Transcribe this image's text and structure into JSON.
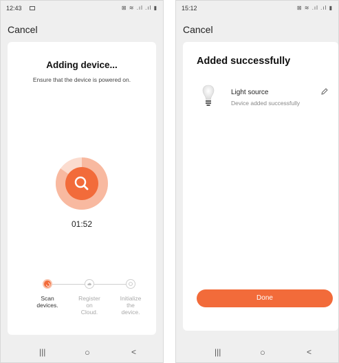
{
  "colors": {
    "accent": "#f26b3a",
    "ring": "#f8c4ae",
    "ring_light": "#fbdccf"
  },
  "left": {
    "status": {
      "time": "12:43",
      "icons": "⊠ ≋ .ıl .ıl ▮"
    },
    "cancel_label": "Cancel",
    "title": "Adding device...",
    "subtitle": "Ensure that the device is powered on.",
    "timer": "01:52",
    "steps": [
      {
        "label": "Scan devices.",
        "icon": "spinner-icon",
        "active": true
      },
      {
        "label": "Register on Cloud.",
        "icon": "cloud-icon",
        "active": false
      },
      {
        "label": "Initialize the device.",
        "icon": "check-circle-icon",
        "active": false
      }
    ],
    "nav": {
      "recents": "|||",
      "home": "○",
      "back": "<"
    }
  },
  "right": {
    "status": {
      "time": "15:12",
      "icons": "⊠ ≋ .ıl .ıl ▮"
    },
    "cancel_label": "Cancel",
    "title": "Added successfully",
    "device": {
      "name": "Light source",
      "status": "Device added successfully",
      "icon": "bulb-icon"
    },
    "done_label": "Done",
    "nav": {
      "recents": "|||",
      "home": "○",
      "back": "<"
    }
  }
}
